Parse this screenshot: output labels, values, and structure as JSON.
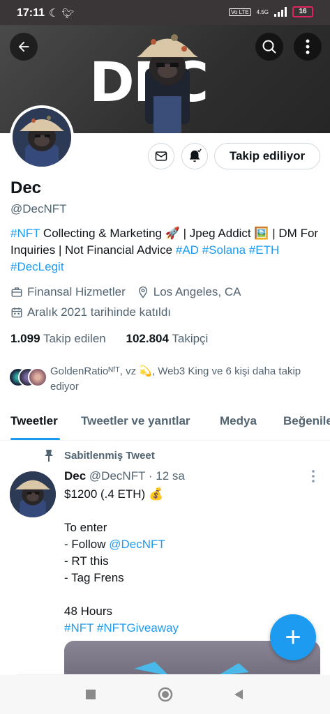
{
  "status": {
    "time": "17:11",
    "network": "4.5G",
    "volte": "Vo LTE",
    "battery": "16"
  },
  "banner": {
    "text": "DEC"
  },
  "profile": {
    "name": "Dec",
    "handle": "@DecNFT",
    "follow_button": "Takip ediliyor",
    "bio": {
      "p1": "#NFT",
      "p2": " Collecting & Marketing 🚀 | Jpeg Addict 🖼️ | DM For Inquiries | Not Financial Advice ",
      "p3": "#AD",
      "p4": "#Solana",
      "p5": "#ETH",
      "p6": "#DecLegit"
    },
    "category": "Finansal Hizmetler",
    "location": "Los Angeles, CA",
    "joined": "Aralık 2021 tarihinde katıldı",
    "following_count": "1.099",
    "following_label": "Takip edilen",
    "followers_count": "102.804",
    "followers_label": "Takipçi",
    "followed_by": "GoldenRatioᴺᶠᵀ, vz 💫, Web3 King ve 6 kişi daha takip ediyor"
  },
  "tabs": [
    "Tweetler",
    "Tweetler ve yanıtlar",
    "Medya",
    "Beğeniler"
  ],
  "tweet": {
    "pinned_label": "Sabitlenmiş Tweet",
    "author": "Dec",
    "handle": "@DecNFT",
    "time": "· 12 sa",
    "line1": "$1200 (.4 ETH) 💰",
    "line2": "To enter",
    "line3": "- Follow ",
    "mention": "@DecNFT",
    "line4": "- RT this",
    "line5": "- Tag Frens",
    "line6": "48 Hours",
    "tags": "#NFT #NFTGiveaway"
  },
  "fab_label": "+",
  "colors": {
    "accent": "#1d9bf0",
    "text": "#0f1419",
    "muted": "#536471",
    "banner": "#3a3536"
  }
}
